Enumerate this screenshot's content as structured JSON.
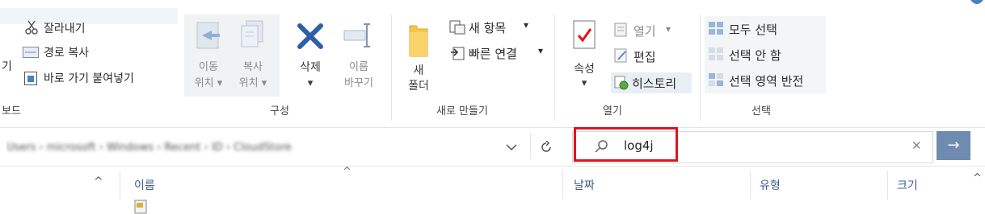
{
  "ribbon": {
    "clipboard": {
      "cut": "잘라내기",
      "copy_path": "경로 복사",
      "paste_shortcut": "바로 가기 붙여넣기",
      "partial_left_text": "기",
      "group_label": "보드"
    },
    "organize": {
      "move_to": [
        "이동",
        "위치"
      ],
      "copy_to": [
        "복사",
        "위치"
      ],
      "delete": "삭제",
      "rename": [
        "이름",
        "바꾸기"
      ],
      "group_label": "구성"
    },
    "new": {
      "new_folder": [
        "새",
        "폴더"
      ],
      "new_item": "새 항목",
      "easy_access": "빠른 연결",
      "group_label": "새로 만들기"
    },
    "open": {
      "properties": "속성",
      "open": "열기",
      "edit": "편집",
      "history": "히스토리",
      "group_label": "열기"
    },
    "select": {
      "select_all": "모두 선택",
      "select_none": "선택 안 함",
      "invert_selection": "선택 영역 반전",
      "group_label": "선택"
    },
    "dropdown_arrow": "▾",
    "dropdown_tri": "▸"
  },
  "address": {
    "path_blurred": "Users  ›  microsoft  ›  Windows  ›  Recent  ›  ID  ›  CloudStore",
    "dropdown_icon": "chevron-down-icon",
    "refresh_icon": "refresh-icon"
  },
  "search": {
    "query": "log4j",
    "search_icon": "search-icon",
    "clear_glyph": "✕",
    "go_glyph": "→"
  },
  "columns": {
    "name": "이름",
    "date": "날짜",
    "type": "유형",
    "size": "크기",
    "sort_glyph": "^",
    "up_glyph": "^"
  },
  "colors": {
    "accent": "#6f8bb0",
    "highlight": "#e0141d",
    "folder": "#f5c64a",
    "delete_x": "#2e5fa7"
  }
}
